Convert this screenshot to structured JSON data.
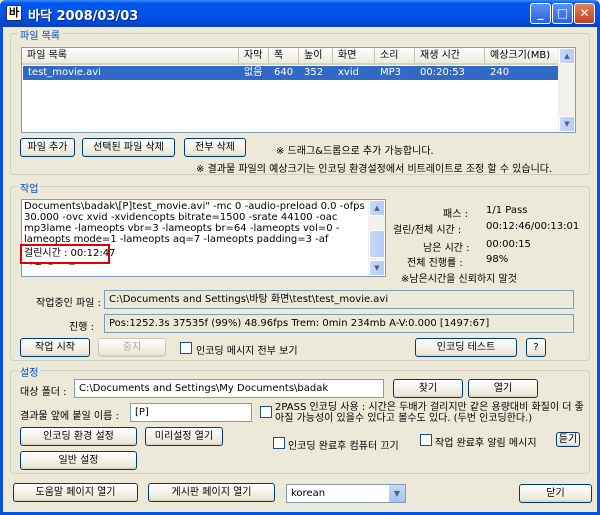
{
  "window": {
    "title": "바닥 2008/03/03",
    "icon_glyph": "바"
  },
  "files": {
    "legend": "파일 목록",
    "columns": [
      "파일 목록",
      "자막",
      "폭",
      "높이",
      "화면",
      "소리",
      "재생 시간",
      "예상크기(MB)"
    ],
    "rows": [
      [
        "test_movie.avi",
        "없음",
        "640",
        "352",
        "xvid",
        "MP3",
        "00:20:53",
        "240"
      ]
    ],
    "buttons": {
      "add": "파일 추가",
      "delete_selected": "선택된 파일 삭제",
      "delete_all": "전부 삭제"
    },
    "hint_dragdrop": "※ 드래그&드롭으로 추가 가능합니다.",
    "hint_size": "※ 결과물 파일의 예상크기는 인코딩 환경설정에서 비트레이트로 조정 할 수 있습니다."
  },
  "job": {
    "legend": "작업",
    "log": "Documents\\badak\\[P]test_movie.avi\" -mc 0 -audio-preload 0.0 -ofps 30.000 -ovc xvid -xvidencopts bitrate=1500 -srate 44100 -oac mp3lame -lameopts vbr=3 -lameopts br=64 -lameopts vol=0 -lameopts mode=1 -lameopts aq=7 -lameopts padding=3 -af volnorm\n작업 정보 완료",
    "elapsed_highlight": "걸린시간 : 00:12:47",
    "stats": [
      {
        "label": "패스 :",
        "value": "1/1 Pass"
      },
      {
        "label": "걸린/전체 시간 :",
        "value": "00:12:46/00:13:01"
      },
      {
        "label": "남은 시간 :",
        "value": "00:00:15"
      },
      {
        "label": "전체 진행률 :",
        "value": "98%"
      }
    ],
    "remaining_note": "※남은시간을 신뢰하지 말것",
    "current_file_label": "작업중인 파일 :",
    "current_file_value": "C:\\Documents and Settings\\바탕 화면\\test\\test_movie.avi",
    "progress_label": "진행 :",
    "progress_value": "Pos:1252.3s  37535f (99%) 48.96fps Trem:   0min 234mb  A-V:0.000 [1497:67]",
    "buttons": {
      "start": "작업 시작",
      "stop": "중지",
      "show_all": "인코딩 메시지 전부 보기",
      "test": "인코딩 테스트",
      "help": "?"
    }
  },
  "settings": {
    "legend": "설정",
    "target_label": "대상 폴더 :",
    "target_value": "C:\\Documents and Settings\\My Documents\\badak",
    "find_button": "찾기",
    "open_button": "열기",
    "prefix_label": "결과물 앞에 붙일 이름 :",
    "prefix_value": "[P]",
    "twopass_text": "2PASS 인코딩 사용 : 시간은 두배가 걸리지만 같은 용량대비 화질이 더 좋아질 가능성이 있을수 있다고 볼수도 있다. (두번 인코딩한다.)",
    "encode_settings_button": "인코딩 환경 설정",
    "preset_button": "미리설정 열기",
    "shutdown_label": "인코딩 완료후 컴퓨터 끄기",
    "notify_label": "작업 완료후 알림 메시지",
    "hide_button": "듣기",
    "general_button": "일반 설정"
  },
  "footer": {
    "help_page": "도움말 페이지 열기",
    "board_page": "게시판 페이지 열기",
    "language": "korean",
    "close": "닫기"
  }
}
